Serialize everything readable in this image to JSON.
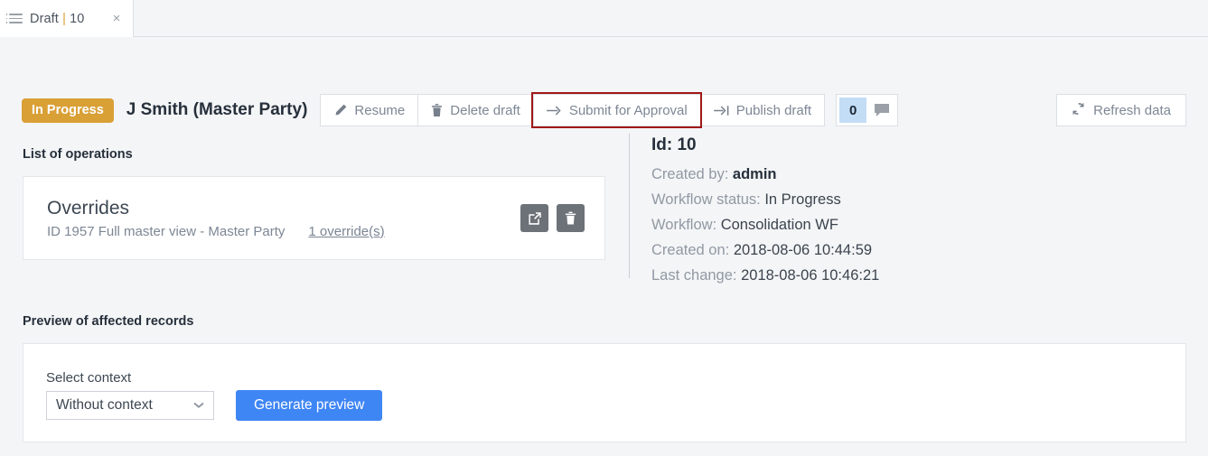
{
  "tab": {
    "icon": "list-icon",
    "title_prefix": "Draft",
    "separator": "|",
    "id": "10",
    "close_label": "×"
  },
  "toolbar": {
    "status_badge": "In Progress",
    "document_title": "J Smith (Master Party)",
    "buttons": [
      {
        "label": "Resume",
        "icon": "pencil-icon"
      },
      {
        "label": "Delete draft",
        "icon": "trash-icon"
      },
      {
        "label": "Submit for Approval",
        "icon": "arrow-right-icon",
        "highlighted": true
      },
      {
        "label": "Publish draft",
        "icon": "arrow-to-bar-icon"
      }
    ],
    "comment_count": "0",
    "comment_icon": "comment-icon",
    "refresh_label": "Refresh data",
    "refresh_icon": "refresh-icon"
  },
  "operations": {
    "section_title": "List of operations",
    "card": {
      "name": "Overrides",
      "subtitle": "ID 1957 Full master view - Master Party",
      "link": "1 override(s)",
      "actions": [
        {
          "name": "open-external-icon"
        },
        {
          "name": "delete-icon"
        }
      ]
    }
  },
  "meta": {
    "id_label": "Id: 10",
    "rows": [
      {
        "label": "Created by:",
        "value": "admin",
        "bold": true
      },
      {
        "label": "Workflow status:",
        "value": "In Progress",
        "bold": false
      },
      {
        "label": "Workflow:",
        "value": "Consolidation WF",
        "bold": false
      },
      {
        "label": "Created on:",
        "value": "2018-08-06 10:44:59",
        "bold": false
      },
      {
        "label": "Last change:",
        "value": "2018-08-06 10:46:21",
        "bold": false
      }
    ]
  },
  "preview": {
    "section_title": "Preview of affected records",
    "select_label": "Select context",
    "select_value": "Without context",
    "select_options": [
      "Without context"
    ],
    "generate_label": "Generate preview"
  },
  "colors": {
    "status_orange": "#d9a036",
    "primary_blue": "#3f86f5",
    "count_badge_blue": "#c3ddf5",
    "highlight_red": "#a01818",
    "page_bg": "#f4f5f7"
  }
}
